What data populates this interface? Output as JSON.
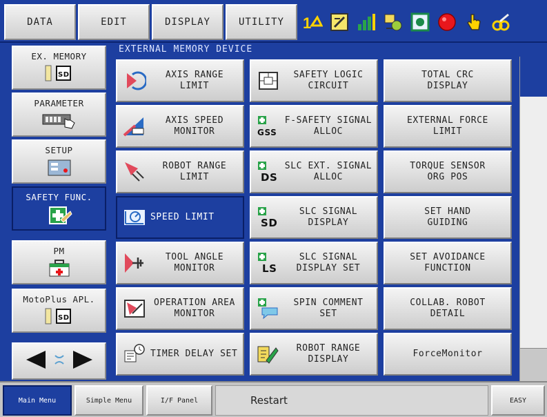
{
  "top_menu": {
    "data": "DATA",
    "edit": "EDIT",
    "display": "DISPLAY",
    "utility": "UTILITY"
  },
  "status_icons": [
    "coord-system-icon",
    "edit-mode-icon",
    "signal-bars-icon",
    "job-icon",
    "play-mode-icon",
    "servo-status-icon",
    "hand-touch-icon",
    "key-security-icon"
  ],
  "left_nav": {
    "ex_memory": "EX. MEMORY",
    "parameter": "PARAMETER",
    "setup": "SETUP",
    "safety_func": "SAFETY FUNC.",
    "pm": "PM",
    "motoplus": "MotoPlus APL.",
    "sd_label": "SD"
  },
  "panel": {
    "title": "EXTERNAL MEMORY DEVICE"
  },
  "functions": {
    "axis_range_limit": "AXIS RANGE\nLIMIT",
    "axis_speed_monitor": "AXIS SPEED\nMONITOR",
    "robot_range_limit": "ROBOT RANGE\nLIMIT",
    "speed_limit": "SPEED LIMIT",
    "tool_angle_monitor": "TOOL ANGLE\nMONITOR",
    "operation_area_monitor": "OPERATION AREA\nMONITOR",
    "timer_delay_set": "TIMER DELAY SET",
    "safety_logic_circuit": "SAFETY LOGIC\nCIRCUIT",
    "fsafety_signal_alloc": "F-SAFETY SIGNAL\nALLOC",
    "slc_ext_signal_alloc": "SLC EXT. SIGNAL\nALLOC",
    "slc_signal_display": "SLC SIGNAL\nDISPLAY",
    "slc_signal_display_set": "SLC SIGNAL\nDISPLAY SET",
    "spin_comment_set": "SPIN COMMENT\nSET",
    "robot_range_display": "ROBOT RANGE\nDISPLAY",
    "total_crc_display": "TOTAL CRC\nDISPLAY",
    "external_force_limit": "EXTERNAL FORCE\nLIMIT",
    "torque_sensor_org_pos": "TORQUE SENSOR\nORG POS",
    "set_hand_guiding": "SET HAND\nGUIDING",
    "set_avoidance_function": "SET AVOIDANCE\nFUNCTION",
    "collab_robot_detail": "COLLAB. ROBOT\nDETAIL",
    "force_monitor": "ForceMonitor"
  },
  "icon_text": {
    "gss": "GSS",
    "ds": "DS",
    "sd": "SD",
    "ls": "LS"
  },
  "bottom_bar": {
    "main_menu": "Main Menu",
    "simple_menu": "Simple Menu",
    "if_panel": "I/F Panel",
    "restart": "Restart",
    "easy": "EASY"
  },
  "colors": {
    "accent": "#1d3fa0",
    "button_face": "#e0e0e0"
  }
}
